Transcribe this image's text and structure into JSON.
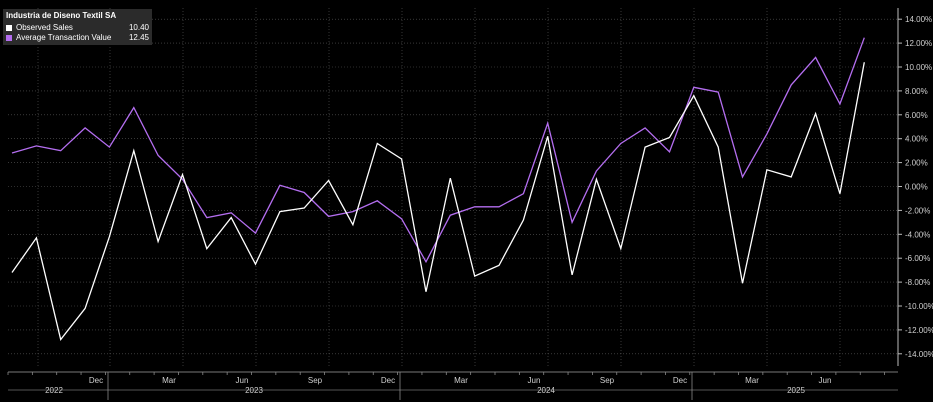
{
  "colors": {
    "background": "#000000",
    "observed": "#ffffff",
    "atv": "#b46ef0",
    "grid": "#5a5a5a",
    "text": "#d0d0d0"
  },
  "legend": {
    "title": "Industria de Diseno Textil SA",
    "items": [
      {
        "name": "Observed Sales",
        "value": "10.40",
        "color": "#ffffff"
      },
      {
        "name": "Average Transaction Value",
        "value": "12.45",
        "color": "#b46ef0"
      }
    ]
  },
  "chart_data": {
    "type": "line",
    "title": "Industria de Diseno Textil SA",
    "x": [
      "2021-09",
      "2021-10",
      "2021-11",
      "2021-12",
      "2022-01",
      "2022-02",
      "2022-03",
      "2022-04",
      "2022-05",
      "2022-06",
      "2022-07",
      "2022-08",
      "2022-09",
      "2022-10",
      "2022-11",
      "2022-12",
      "2023-01",
      "2023-02",
      "2023-03",
      "2023-04",
      "2023-05",
      "2023-06",
      "2023-07",
      "2023-08",
      "2023-09",
      "2023-10",
      "2023-11",
      "2023-12",
      "2024-01",
      "2024-02",
      "2024-03",
      "2024-04",
      "2024-05",
      "2024-06",
      "2024-07",
      "2024-08",
      "2024-09",
      "2024-10",
      "2024-11"
    ],
    "series": [
      {
        "name": "Observed Sales",
        "values": [
          -7.2,
          -4.3,
          -12.8,
          -10.2,
          -4.2,
          3.0,
          -4.6,
          1.0,
          -5.2,
          -2.6,
          -6.5,
          -2.1,
          -1.8,
          0.5,
          -3.2,
          3.6,
          2.3,
          -8.8,
          0.7,
          -7.5,
          -6.6,
          -2.8,
          4.2,
          -7.4,
          0.6,
          -5.2,
          3.3,
          4.1,
          7.6,
          3.3,
          -8.1,
          1.4,
          0.8,
          6.1,
          -0.6,
          10.4
        ]
      },
      {
        "name": "Average Transaction Value",
        "values": [
          2.8,
          3.4,
          3.0,
          4.9,
          3.3,
          6.6,
          2.6,
          0.6,
          -2.6,
          -2.2,
          -3.9,
          0.1,
          -0.5,
          -2.5,
          -2.1,
          -1.2,
          -2.7,
          -6.3,
          -2.4,
          -1.7,
          -1.7,
          -0.6,
          5.3,
          -3.0,
          1.3,
          3.6,
          4.9,
          2.9,
          8.3,
          7.9,
          0.8,
          4.4,
          8.5,
          10.8,
          6.9,
          12.45
        ]
      }
    ],
    "ylim": [
      -15,
      15
    ],
    "y_ticks": [
      "14.00%",
      "12.00%",
      "10.00%",
      "8.00%",
      "6.00%",
      "4.00%",
      "2.00%",
      "0.00%",
      "-2.00%",
      "-4.00%",
      "-6.00%",
      "-8.00%",
      "-10.00%",
      "-12.00%",
      "-14.00%"
    ],
    "x_month_labels": [
      "Dec",
      "Mar",
      "Jun",
      "Sep",
      "Dec",
      "Mar",
      "Jun",
      "Sep",
      "Dec",
      "Mar",
      "Jun"
    ],
    "x_year_labels": [
      "2022",
      "2023",
      "2024",
      "2025"
    ],
    "grid": true,
    "legend_position": "top-left"
  }
}
